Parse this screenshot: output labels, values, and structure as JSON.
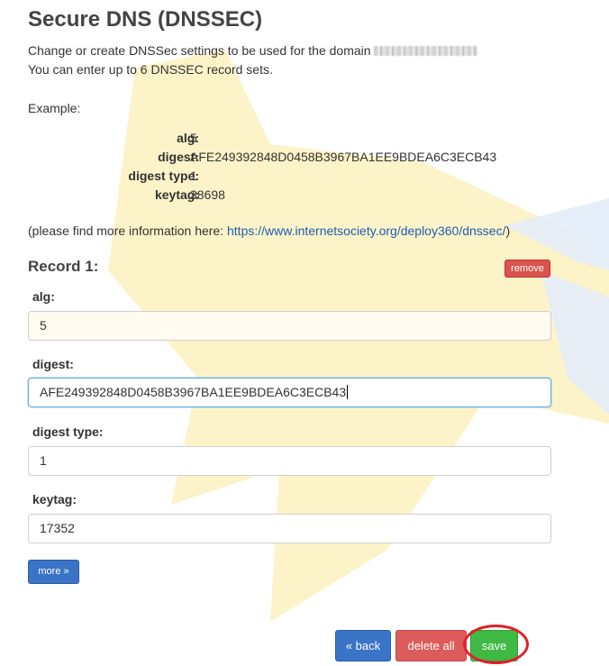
{
  "page": {
    "title": "Secure DNS (DNSSEC)",
    "intro_line1": "Change or create DNSSec settings to be used for the domain",
    "intro_line2": "You can enter up to 6 DNSSEC record sets.",
    "example_label": "Example:",
    "example": [
      {
        "key": "alg:",
        "value": "5"
      },
      {
        "key": "digest:",
        "value": "AFE249392848D0458B3967BA1EE9BDEA6C3ECB43"
      },
      {
        "key": "digest type:",
        "value": "1"
      },
      {
        "key": "keytag:",
        "value": "38698"
      }
    ],
    "info_prefix": "(please find more information here: ",
    "info_link": "https://www.internetsociety.org/deploy360/dnssec/",
    "info_suffix": ")"
  },
  "record": {
    "title": "Record 1:",
    "remove_label": "remove",
    "fields": {
      "alg": {
        "label": "alg:",
        "value": "5"
      },
      "digest": {
        "label": "digest:",
        "value": "AFE249392848D0458B3967BA1EE9BDEA6C3ECB43"
      },
      "digest_type": {
        "label": "digest type:",
        "value": "1"
      },
      "keytag": {
        "label": "keytag:",
        "value": "17352"
      }
    },
    "more_label": "more »"
  },
  "actions": {
    "back_label": "« back",
    "delete_all_label": "delete all",
    "save_label": "save"
  },
  "colors": {
    "primary": "#3a74c7",
    "danger": "#d9534f",
    "success": "#3fb944",
    "watermark": "#fdf0b8",
    "watermark_blue": "#e3ecf8",
    "annotation_ring": "#e0202a"
  },
  "icons": {
    "watermark": "bird-logo-icon"
  }
}
